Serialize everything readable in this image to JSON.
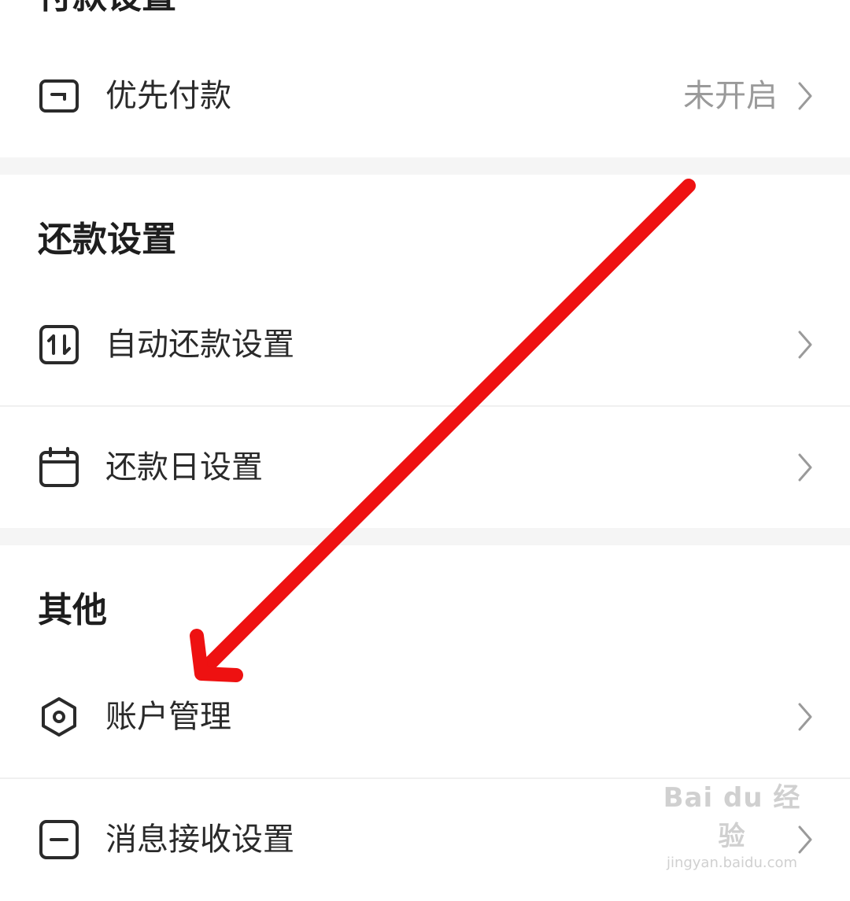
{
  "sections": {
    "payment": {
      "title": "付款设置",
      "items": [
        {
          "label": "优先付款",
          "value": "未开启",
          "icon": "wallet-icon"
        }
      ]
    },
    "repayment": {
      "title": "还款设置",
      "items": [
        {
          "label": "自动还款设置",
          "icon": "auto-repay-icon"
        },
        {
          "label": "还款日设置",
          "icon": "calendar-icon"
        }
      ]
    },
    "other": {
      "title": "其他",
      "items": [
        {
          "label": "账户管理",
          "icon": "hexagon-settings-icon"
        },
        {
          "label": "消息接收设置",
          "icon": "message-icon"
        }
      ]
    }
  },
  "annotation": {
    "arrow_color": "#ee1111",
    "points_to": "账户管理"
  },
  "watermark": {
    "brand": "Bai du 经验",
    "url": "jingyan.baidu.com"
  },
  "colors": {
    "gap": "#f5f5f5",
    "divider": "#f0f0f0",
    "secondary_text": "#9a9a9a"
  }
}
